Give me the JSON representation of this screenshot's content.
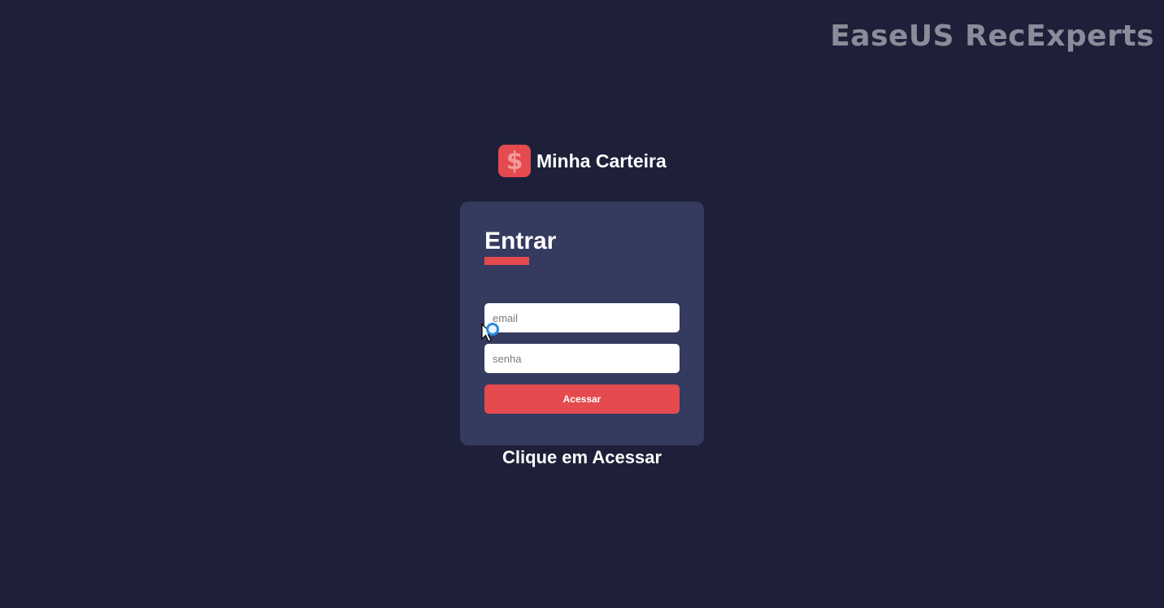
{
  "watermark": "EaseUS RecExperts",
  "brand": {
    "logo_symbol": "$",
    "name": "Minha Carteira"
  },
  "login": {
    "title": "Entrar",
    "email_placeholder": "email",
    "password_placeholder": "senha",
    "submit_label": "Acessar"
  },
  "hint": "Clique em Acessar",
  "colors": {
    "background": "#1d2038",
    "card": "#353a5f",
    "accent": "#e54a4f"
  }
}
